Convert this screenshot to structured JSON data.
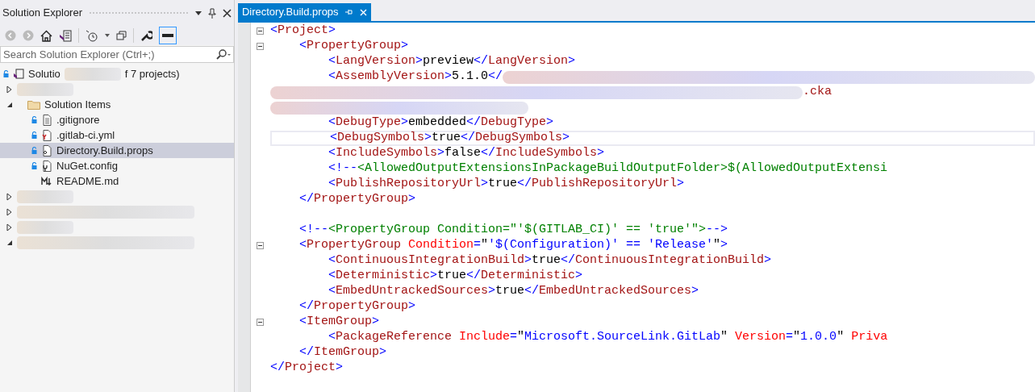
{
  "explorer": {
    "title": "Solution Explorer",
    "search": {
      "placeholder": "Search Solution Explorer (Ctrl+;)"
    },
    "tree": [
      {
        "kind": "solution",
        "locked": true,
        "label": "Solutio",
        "label_end": "f 7 projects)"
      },
      {
        "kind": "redacted",
        "expanded": false
      },
      {
        "kind": "folder",
        "expanded": true,
        "label": "Solution Items",
        "children": [
          {
            "kind": "text",
            "locked": true,
            "selected": false,
            "label": ".gitignore"
          },
          {
            "kind": "yaml",
            "locked": true,
            "selected": false,
            "label": ".gitlab-ci.yml"
          },
          {
            "kind": "props",
            "locked": true,
            "selected": true,
            "label": "Directory.Build.props"
          },
          {
            "kind": "config",
            "locked": true,
            "selected": false,
            "label": "NuGet.config"
          },
          {
            "kind": "markdown",
            "locked": false,
            "selected": false,
            "label": "README.md"
          }
        ]
      },
      {
        "kind": "redacted",
        "expanded": false
      },
      {
        "kind": "redacted",
        "expanded": false
      },
      {
        "kind": "redacted",
        "expanded": false
      },
      {
        "kind": "redacted",
        "expanded": true
      }
    ]
  },
  "editor": {
    "tab": {
      "label": "Directory.Build.props",
      "selected": true
    },
    "lines": [
      {
        "fold": true,
        "tokens": [
          {
            "kind": "delim",
            "text": "<"
          },
          {
            "kind": "tag",
            "text": "Project"
          },
          {
            "kind": "delim",
            "text": ">"
          }
        ]
      },
      {
        "fold": true,
        "tokens": [
          {
            "kind": "delim",
            "text": "    <"
          },
          {
            "kind": "tag",
            "text": "PropertyGroup"
          },
          {
            "kind": "delim",
            "text": ">"
          }
        ]
      },
      {
        "fold": false,
        "tokens": [
          {
            "kind": "delim",
            "text": "        <"
          },
          {
            "kind": "tag",
            "text": "LangVersion"
          },
          {
            "kind": "delim",
            "text": ">"
          },
          {
            "kind": "text",
            "text": "preview"
          },
          {
            "kind": "delim",
            "text": "</"
          },
          {
            "kind": "tag",
            "text": "LangVersion"
          },
          {
            "kind": "delim",
            "text": ">"
          }
        ]
      },
      {
        "fold": false,
        "tokens": [
          {
            "kind": "delim",
            "text": "        <"
          },
          {
            "kind": "tag",
            "text": "AssemblyVersion"
          },
          {
            "kind": "delim",
            "text": ">"
          },
          {
            "kind": "text",
            "text": "5.1.0"
          },
          {
            "kind": "delim",
            "text": "</"
          },
          {
            "kind": "redacted"
          }
        ]
      },
      {
        "fold": false,
        "tokens": [
          {
            "kind": "redacted"
          },
          {
            "kind": "tag",
            "text": ".cka"
          }
        ]
      },
      {
        "fold": false,
        "tokens": [
          {
            "kind": "redacted"
          }
        ]
      },
      {
        "fold": false,
        "tokens": [
          {
            "kind": "delim",
            "text": "        <"
          },
          {
            "kind": "tag",
            "text": "DebugType"
          },
          {
            "kind": "delim",
            "text": ">"
          },
          {
            "kind": "text",
            "text": "embedded"
          },
          {
            "kind": "delim",
            "text": "</"
          },
          {
            "kind": "tag",
            "text": "DebugType"
          },
          {
            "kind": "delim",
            "text": ">"
          }
        ]
      },
      {
        "fold": false,
        "current": true,
        "tokens": [
          {
            "kind": "delim",
            "text": "        <"
          },
          {
            "kind": "tag",
            "text": "DebugSymbols"
          },
          {
            "kind": "delim",
            "text": ">"
          },
          {
            "kind": "text",
            "text": "true"
          },
          {
            "kind": "delim",
            "text": "</"
          },
          {
            "kind": "tag",
            "text": "DebugSymbols"
          },
          {
            "kind": "delim",
            "text": ">"
          }
        ]
      },
      {
        "fold": false,
        "tokens": [
          {
            "kind": "delim",
            "text": "        <"
          },
          {
            "kind": "tag",
            "text": "IncludeSymbols"
          },
          {
            "kind": "delim",
            "text": ">"
          },
          {
            "kind": "text",
            "text": "false"
          },
          {
            "kind": "delim",
            "text": "</"
          },
          {
            "kind": "tag",
            "text": "IncludeSymbols"
          },
          {
            "kind": "delim",
            "text": ">"
          }
        ]
      },
      {
        "fold": false,
        "tokens": [
          {
            "kind": "delim",
            "text": "        <!--"
          },
          {
            "kind": "comment",
            "text": "<AllowedOutputExtensionsInPackageBuildOutputFolder>$(AllowedOutputExtensi"
          }
        ]
      },
      {
        "fold": false,
        "tokens": [
          {
            "kind": "delim",
            "text": "        <"
          },
          {
            "kind": "tag",
            "text": "PublishRepositoryUrl"
          },
          {
            "kind": "delim",
            "text": ">"
          },
          {
            "kind": "text",
            "text": "true"
          },
          {
            "kind": "delim",
            "text": "</"
          },
          {
            "kind": "tag",
            "text": "PublishRepositoryUrl"
          },
          {
            "kind": "delim",
            "text": ">"
          }
        ]
      },
      {
        "fold": false,
        "tokens": [
          {
            "kind": "delim",
            "text": "    </"
          },
          {
            "kind": "tag",
            "text": "PropertyGroup"
          },
          {
            "kind": "delim",
            "text": ">"
          }
        ]
      },
      {
        "fold": false
      },
      {
        "fold": false,
        "tokens": [
          {
            "kind": "delim",
            "text": "    <!--"
          },
          {
            "kind": "comment",
            "text": "<PropertyGroup Condition=\"'$(GITLAB_CI)' == 'true'\">"
          },
          {
            "kind": "delim",
            "text": "-->"
          }
        ]
      },
      {
        "fold": true,
        "tokens": [
          {
            "kind": "delim",
            "text": "    <"
          },
          {
            "kind": "tag",
            "text": "PropertyGroup"
          },
          {
            "kind": "attr",
            "text": " Condition"
          },
          {
            "kind": "delim",
            "text": "="
          },
          {
            "kind": "text",
            "text": "\""
          },
          {
            "kind": "value",
            "text": "'$(Configuration)' == 'Release'"
          },
          {
            "kind": "text",
            "text": "\""
          },
          {
            "kind": "delim",
            "text": ">"
          }
        ]
      },
      {
        "fold": false,
        "tokens": [
          {
            "kind": "delim",
            "text": "        <"
          },
          {
            "kind": "tag",
            "text": "ContinuousIntegrationBuild"
          },
          {
            "kind": "delim",
            "text": ">"
          },
          {
            "kind": "text",
            "text": "true"
          },
          {
            "kind": "delim",
            "text": "</"
          },
          {
            "kind": "tag",
            "text": "ContinuousIntegrationBuild"
          },
          {
            "kind": "delim",
            "text": ">"
          }
        ]
      },
      {
        "fold": false,
        "tokens": [
          {
            "kind": "delim",
            "text": "        <"
          },
          {
            "kind": "tag",
            "text": "Deterministic"
          },
          {
            "kind": "delim",
            "text": ">"
          },
          {
            "kind": "text",
            "text": "true"
          },
          {
            "kind": "delim",
            "text": "</"
          },
          {
            "kind": "tag",
            "text": "Deterministic"
          },
          {
            "kind": "delim",
            "text": ">"
          }
        ]
      },
      {
        "fold": false,
        "tokens": [
          {
            "kind": "delim",
            "text": "        <"
          },
          {
            "kind": "tag",
            "text": "EmbedUntrackedSources"
          },
          {
            "kind": "delim",
            "text": ">"
          },
          {
            "kind": "text",
            "text": "true"
          },
          {
            "kind": "delim",
            "text": "</"
          },
          {
            "kind": "tag",
            "text": "EmbedUntrackedSources"
          },
          {
            "kind": "delim",
            "text": ">"
          }
        ]
      },
      {
        "fold": false,
        "tokens": [
          {
            "kind": "delim",
            "text": "    </"
          },
          {
            "kind": "tag",
            "text": "PropertyGroup"
          },
          {
            "kind": "delim",
            "text": ">"
          }
        ]
      },
      {
        "fold": true,
        "tokens": [
          {
            "kind": "delim",
            "text": "    <"
          },
          {
            "kind": "tag",
            "text": "ItemGroup"
          },
          {
            "kind": "delim",
            "text": ">"
          }
        ]
      },
      {
        "fold": false,
        "tokens": [
          {
            "kind": "delim",
            "text": "        <"
          },
          {
            "kind": "tag",
            "text": "PackageReference"
          },
          {
            "kind": "attr",
            "text": " Include"
          },
          {
            "kind": "delim",
            "text": "="
          },
          {
            "kind": "text",
            "text": "\""
          },
          {
            "kind": "value",
            "text": "Microsoft.SourceLink.GitLab"
          },
          {
            "kind": "text",
            "text": "\" "
          },
          {
            "kind": "attr",
            "text": "Version"
          },
          {
            "kind": "delim",
            "text": "="
          },
          {
            "kind": "text",
            "text": "\""
          },
          {
            "kind": "value",
            "text": "1.0.0"
          },
          {
            "kind": "text",
            "text": "\" "
          },
          {
            "kind": "attr",
            "text": "Priva"
          }
        ]
      },
      {
        "fold": false,
        "tokens": [
          {
            "kind": "delim",
            "text": "    </"
          },
          {
            "kind": "tag",
            "text": "ItemGroup"
          },
          {
            "kind": "delim",
            "text": ">"
          }
        ]
      },
      {
        "fold": false,
        "tokens": [
          {
            "kind": "delim",
            "text": "</"
          },
          {
            "kind": "tag",
            "text": "Project"
          },
          {
            "kind": "delim",
            "text": ">"
          }
        ]
      }
    ]
  }
}
